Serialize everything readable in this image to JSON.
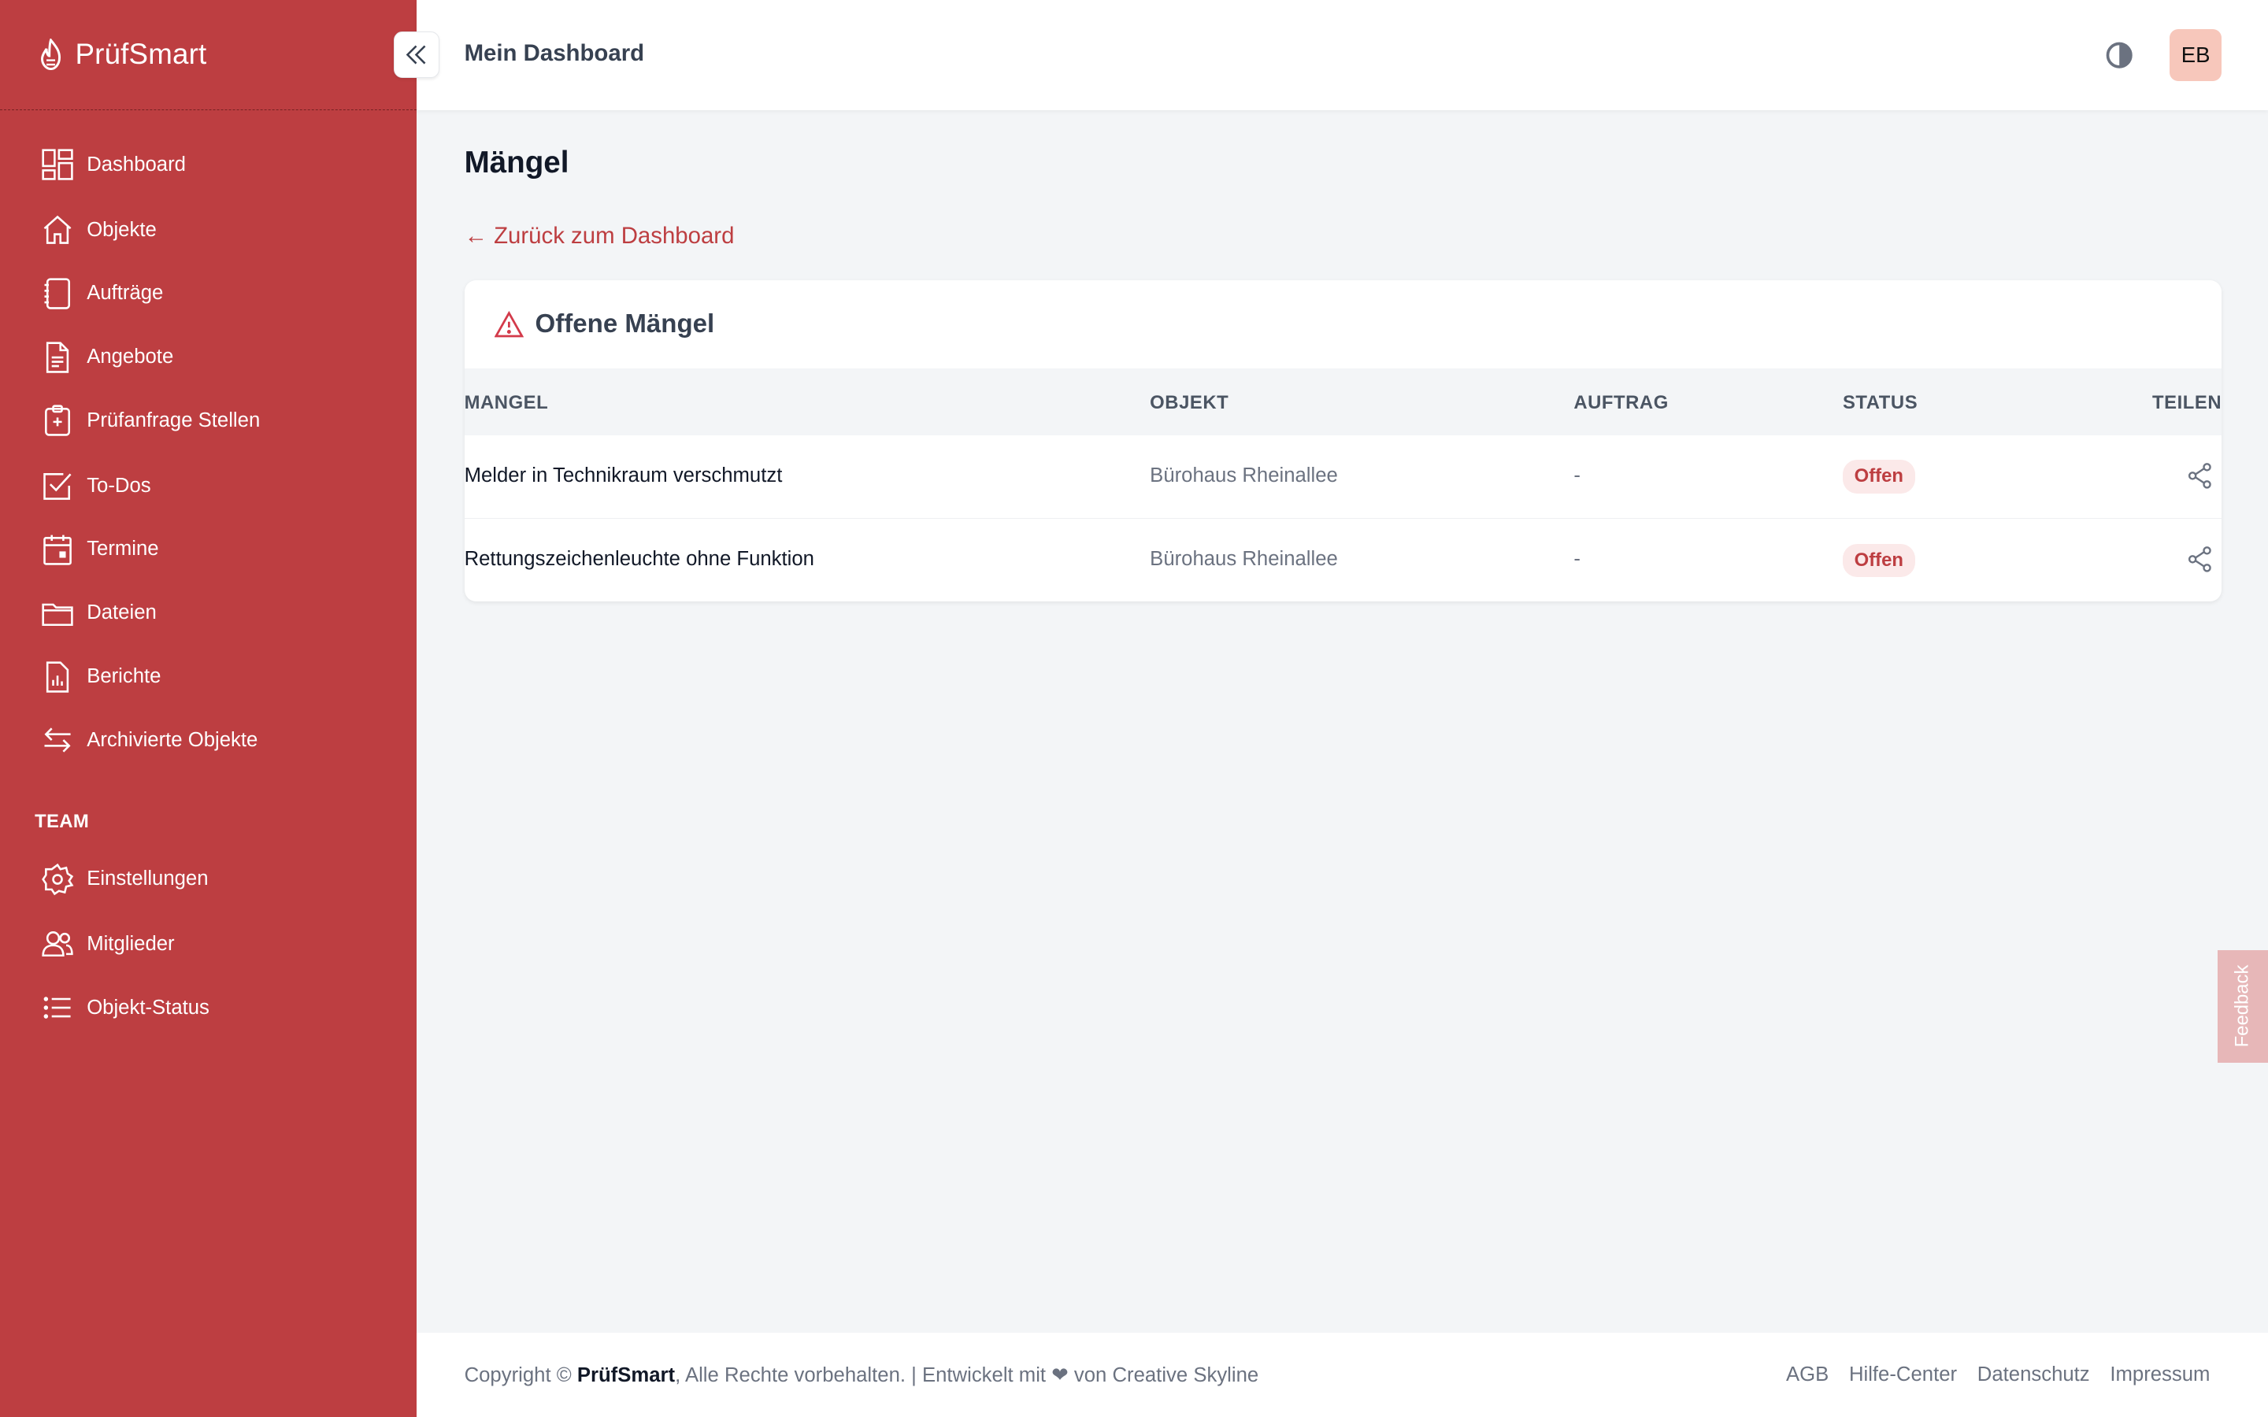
{
  "brand": {
    "name": "PrüfSmart"
  },
  "sidebar": {
    "items": [
      {
        "label": "Dashboard",
        "icon": "dashboard-icon"
      },
      {
        "label": "Objekte",
        "icon": "home-icon"
      },
      {
        "label": "Aufträge",
        "icon": "notebook-icon"
      },
      {
        "label": "Angebote",
        "icon": "document-icon"
      },
      {
        "label": "Prüfanfrage Stellen",
        "icon": "clipboard-plus-icon"
      },
      {
        "label": "To-Dos",
        "icon": "checkbox-icon"
      },
      {
        "label": "Termine",
        "icon": "calendar-icon"
      },
      {
        "label": "Dateien",
        "icon": "folder-icon"
      },
      {
        "label": "Berichte",
        "icon": "report-icon"
      },
      {
        "label": "Archivierte Objekte",
        "icon": "arrows-icon"
      }
    ],
    "team_label": "TEAM",
    "team_items": [
      {
        "label": "Einstellungen",
        "icon": "gear-icon"
      },
      {
        "label": "Mitglieder",
        "icon": "users-icon"
      },
      {
        "label": "Objekt-Status",
        "icon": "list-icon"
      }
    ]
  },
  "header": {
    "title": "Mein Dashboard",
    "avatar_initials": "EB"
  },
  "main": {
    "title": "Mängel",
    "back_link": "← Zurück zum Dashboard",
    "card_title": "Offene Mängel",
    "columns": [
      "MANGEL",
      "OBJEKT",
      "AUFTRAG",
      "STATUS",
      "TEILEN"
    ],
    "rows": [
      {
        "mangel": "Melder in Technikraum verschmutzt",
        "objekt": "Bürohaus Rheinallee",
        "auftrag": "-",
        "status": "Offen"
      },
      {
        "mangel": "Rettungszeichenleuchte ohne Funktion",
        "objekt": "Bürohaus Rheinallee",
        "auftrag": "-",
        "status": "Offen"
      }
    ]
  },
  "feedback_label": "Feedback",
  "footer": {
    "copyright_prefix": "Copyright ©",
    "brand": "PrüfSmart",
    "copyright_suffix": ", Alle Rechte vorbehalten. | Entwickelt mit ❤ von Creative Skyline",
    "links": [
      "AGB",
      "Hilfe-Center",
      "Datenschutz",
      "Impressum"
    ]
  },
  "colors": {
    "primary": "#bd3e41",
    "badge_bg": "#fbe9e9",
    "avatar_bg": "#f7c7bb"
  }
}
